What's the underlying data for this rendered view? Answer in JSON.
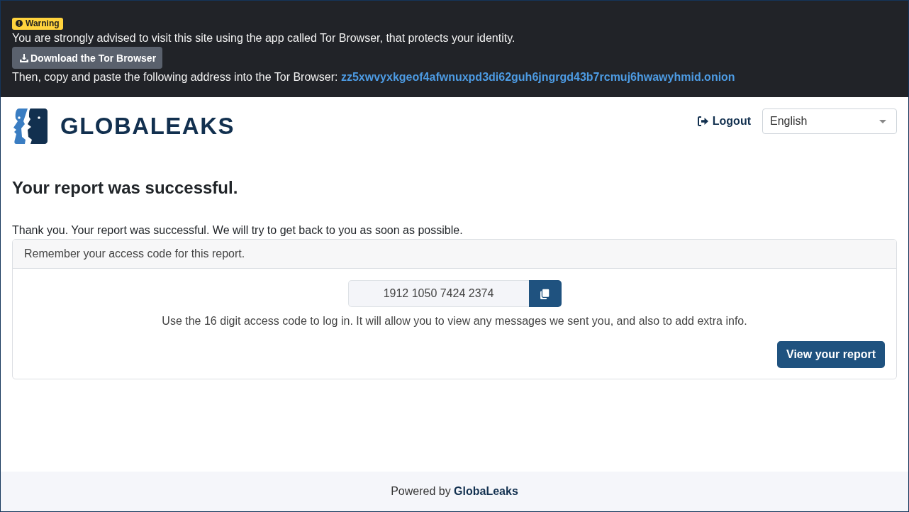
{
  "warning_banner": {
    "badge": "Warning",
    "message": "You are strongly advised to visit this site using the app called Tor Browser, that protects your identity.",
    "download_button": "Download the Tor Browser",
    "address_prompt": "Then, copy and paste the following address into the Tor Browser:",
    "onion_address": "zz5xwvyxkgeof4afwnuxpd3di62guh6jngrgd43b7rcmuj6hwawyhmid.onion"
  },
  "header": {
    "logo_text": "GLOBALEAKS",
    "logout": "Logout",
    "language_select": {
      "value": "English"
    }
  },
  "heading": "Your report was successful.",
  "message": "Thank you. Your report was successful. We will try to get back to you as soon as possible.",
  "receipt_card": {
    "header": "Remember your access code for this report.",
    "access_code": "1912 1050 7424 2374",
    "hint": "Use the 16 digit access code to log in. It will allow you to view any messages we sent you, and also to add extra info.",
    "view_button": "View your report"
  },
  "footer": {
    "text": "Powered by **GlobaLeaks**"
  }
}
